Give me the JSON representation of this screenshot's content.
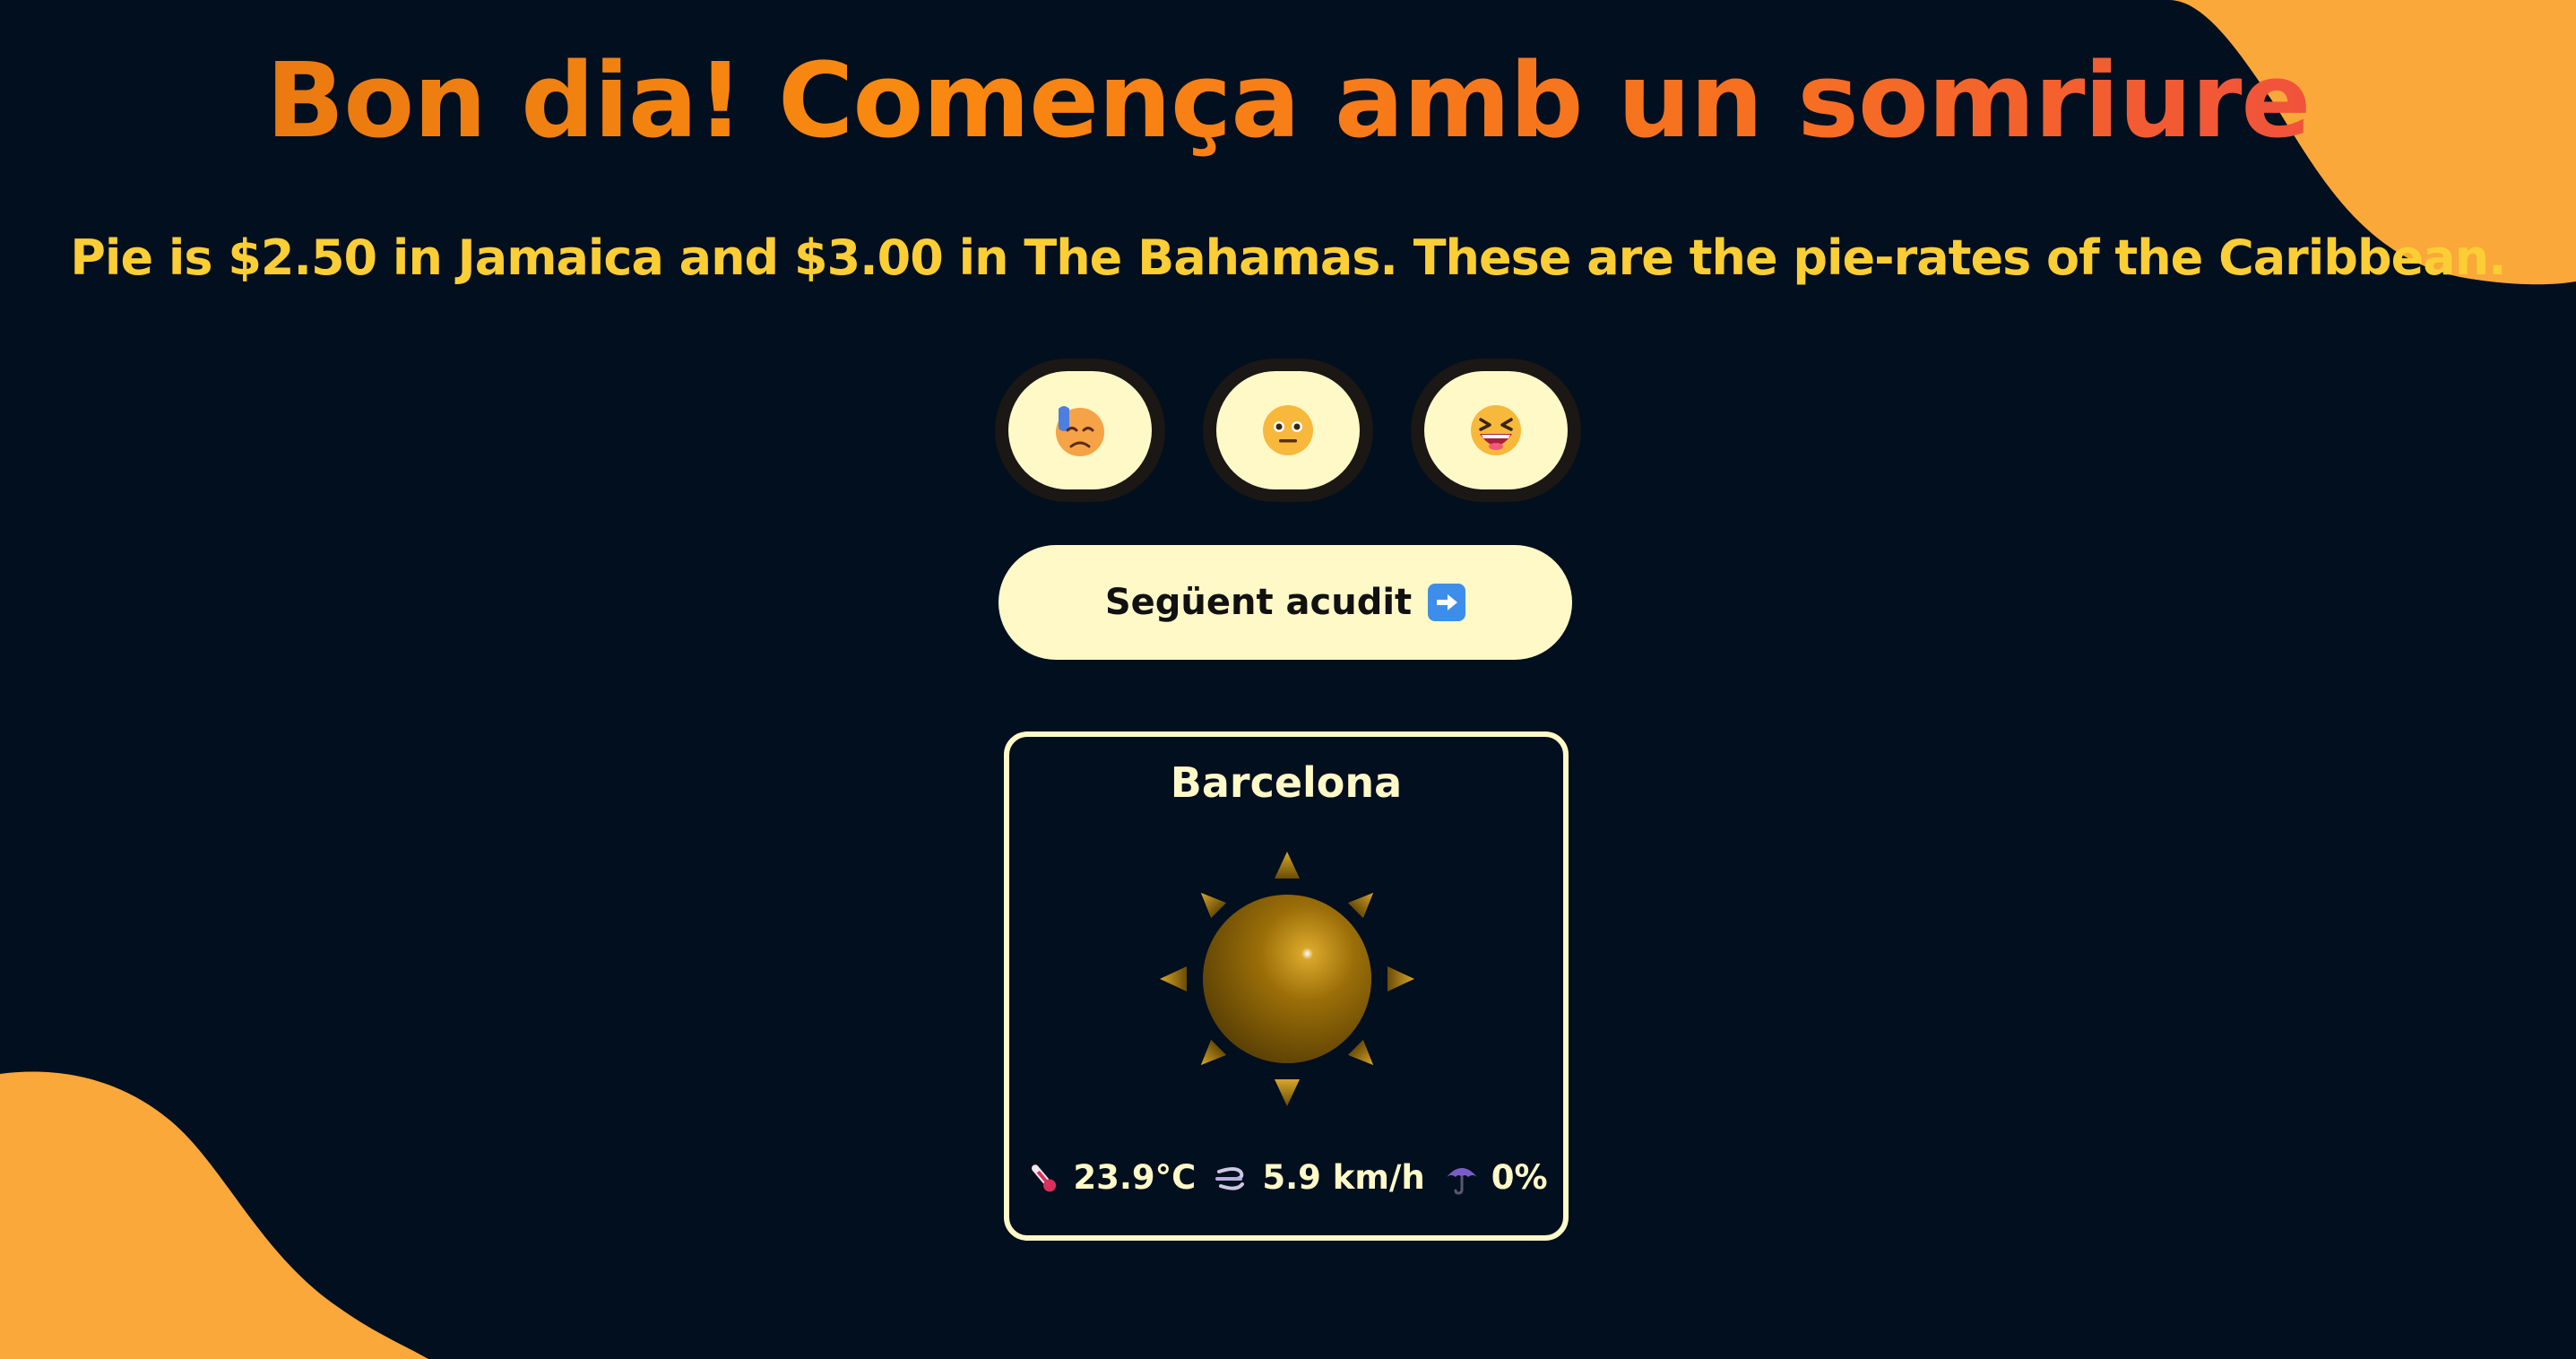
{
  "header": {
    "title": "Bon dia! Comença amb un somriure",
    "joke": "Pie is $2.50 in Jamaica and $3.00 in The Bahamas. These are the pie-rates of the Caribbean."
  },
  "reactions": [
    {
      "icon": "sad-sweat-face-icon"
    },
    {
      "icon": "neutral-face-icon"
    },
    {
      "icon": "laughing-face-icon"
    }
  ],
  "next_button": {
    "label": "Següent acudit",
    "icon": "right-arrow-icon"
  },
  "weather": {
    "city": "Barcelona",
    "condition_icon": "sun-icon",
    "temperature": "23.9°C",
    "wind": "5.9 km/h",
    "precipitation": "0%"
  },
  "colors": {
    "background": "#020f1e",
    "accent_orange": "#faa83a",
    "joke_yellow": "#fcce35",
    "cream": "#fff9c8"
  }
}
